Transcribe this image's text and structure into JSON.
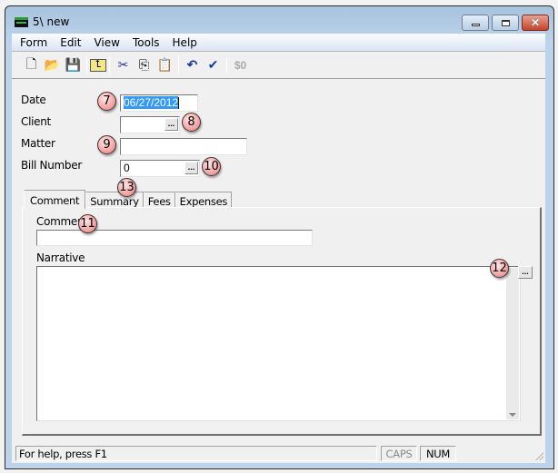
{
  "window": {
    "title": "5\\ new",
    "controls": {
      "minimize": "minimize",
      "maximize": "maximize",
      "close": "✕"
    }
  },
  "menubar": [
    "Form",
    "Edit",
    "View",
    "Tools",
    "Help"
  ],
  "toolbar": {
    "buttons": [
      {
        "name": "new-document-icon",
        "glyph": "🗋"
      },
      {
        "name": "open-folder-icon",
        "glyph": "📂"
      },
      {
        "name": "save-icon",
        "glyph": "💾"
      },
      {
        "name": "up-folder-icon",
        "glyph": "⮤"
      },
      {
        "name": "cut-icon",
        "glyph": "✂"
      },
      {
        "name": "copy-icon",
        "glyph": "⎘"
      },
      {
        "name": "paste-icon",
        "glyph": "📋"
      },
      {
        "name": "undo-icon",
        "glyph": "↶"
      },
      {
        "name": "spellcheck-icon",
        "glyph": "✔"
      }
    ],
    "disabled_label": "$0"
  },
  "form": {
    "date_label": "Date",
    "date_value": "06/27/2012",
    "client_label": "Client",
    "client_value": "",
    "matter_label": "Matter",
    "matter_value": "",
    "bill_number_label": "Bill Number",
    "bill_number_value": "0",
    "ellipsis": "..."
  },
  "badges": {
    "date": "7",
    "client": "8",
    "matter": "9",
    "bill_number": "10",
    "comment": "11",
    "narrative": "12",
    "tabs": "13"
  },
  "tabs": [
    {
      "label": "Comment",
      "active": true
    },
    {
      "label": "Summary",
      "active": false
    },
    {
      "label": "Fees",
      "active": false
    },
    {
      "label": "Expenses",
      "active": false
    }
  ],
  "comment_tab": {
    "comment_label": "Comment",
    "comment_value": "",
    "narrative_label": "Narrative",
    "narrative_value": ""
  },
  "statusbar": {
    "help_text": "For help, press F1",
    "caps": "CAPS",
    "num": "NUM"
  }
}
